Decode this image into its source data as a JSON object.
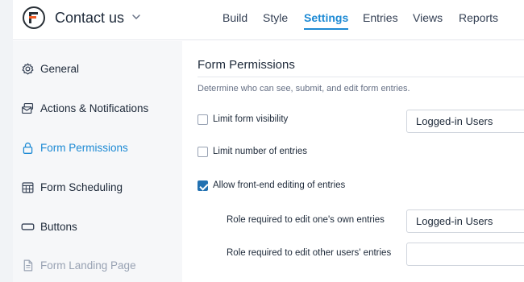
{
  "header": {
    "form_title": "Contact us",
    "tabs": [
      {
        "label": "Build"
      },
      {
        "label": "Style"
      },
      {
        "label": "Settings",
        "active": true
      },
      {
        "label": "Entries"
      },
      {
        "label": "Views"
      },
      {
        "label": "Reports"
      }
    ]
  },
  "sidebar": {
    "items": [
      {
        "label": "General",
        "icon": "gear-icon"
      },
      {
        "label": "Actions & Notifications",
        "icon": "envelope-stack-icon"
      },
      {
        "label": "Form Permissions",
        "icon": "lock-icon",
        "active": true
      },
      {
        "label": "Form Scheduling",
        "icon": "calendar-icon"
      },
      {
        "label": "Buttons",
        "icon": "button-icon"
      },
      {
        "label": "Form Landing Page",
        "icon": "page-icon",
        "disabled": true
      }
    ]
  },
  "main": {
    "title": "Form Permissions",
    "description": "Determine who can see, submit, and edit form entries.",
    "options": {
      "limit_visibility": {
        "label": "Limit form visibility",
        "checked": false,
        "select_value": "Logged-in Users"
      },
      "limit_entries": {
        "label": "Limit number of entries",
        "checked": false
      },
      "front_end_edit": {
        "label": "Allow front-end editing of entries",
        "checked": true
      },
      "role_own": {
        "label": "Role required to edit one's own entries",
        "select_value": "Logged-in Users"
      },
      "role_others": {
        "label": "Role required to edit other users' entries",
        "select_value": ""
      }
    }
  },
  "colors": {
    "accent": "#1d8ad4",
    "checkbox_checked": "#2271b1",
    "sidebar_bg": "#f6f7f9"
  }
}
